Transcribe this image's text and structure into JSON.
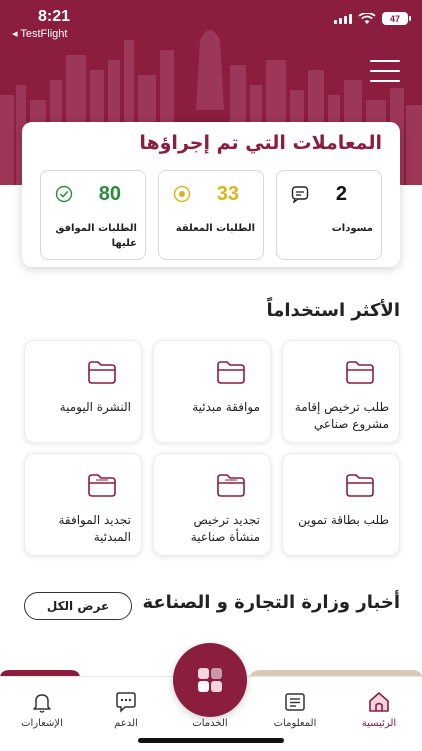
{
  "status": {
    "time": "8:21",
    "back_label": "◂ TestFlight",
    "battery": "47"
  },
  "header": {
    "menu_icon": "hamburger-icon"
  },
  "transactions": {
    "title": "المعاملات التي تم إجراؤها",
    "stats": [
      {
        "count": "2",
        "label": "مسودات",
        "icon": "chat-icon",
        "color": "#111111"
      },
      {
        "count": "33",
        "label": "الطلبات المعلقة",
        "icon": "pending-dot-icon",
        "color": "#d9b51c"
      },
      {
        "count": "80",
        "label": "الطلبات الموافق عليها",
        "icon": "check-circle-icon",
        "color": "#2e8b3a"
      }
    ]
  },
  "most_used": {
    "title": "الأكثر استخداماً",
    "tiles": [
      {
        "label": "طلب ترخيص إقامة مشروع صناعي",
        "icon": "folder-icon"
      },
      {
        "label": "موافقة مبدئية",
        "icon": "folder-icon"
      },
      {
        "label": "النشرة اليومية",
        "icon": "folder-icon"
      },
      {
        "label": "طلب بطاقة تموين",
        "icon": "folder-icon"
      },
      {
        "label": "تجديد ترخيص منشأة صناعية",
        "icon": "document-folder-icon"
      },
      {
        "label": "تجديد الموافقة المبدئية",
        "icon": "document-folder-icon"
      }
    ]
  },
  "news": {
    "title": "أخبار وزارة التجارة و الصناعة",
    "view_all": "عرض الكل"
  },
  "tabbar": {
    "home": "الرئيسية",
    "info": "المعلومات",
    "services": "الخدمات",
    "support": "الدعم",
    "notifications": "الإشعارات"
  },
  "colors": {
    "brand": "#8b1d3f",
    "approved": "#2e8b3a",
    "pending": "#d9b51c"
  }
}
